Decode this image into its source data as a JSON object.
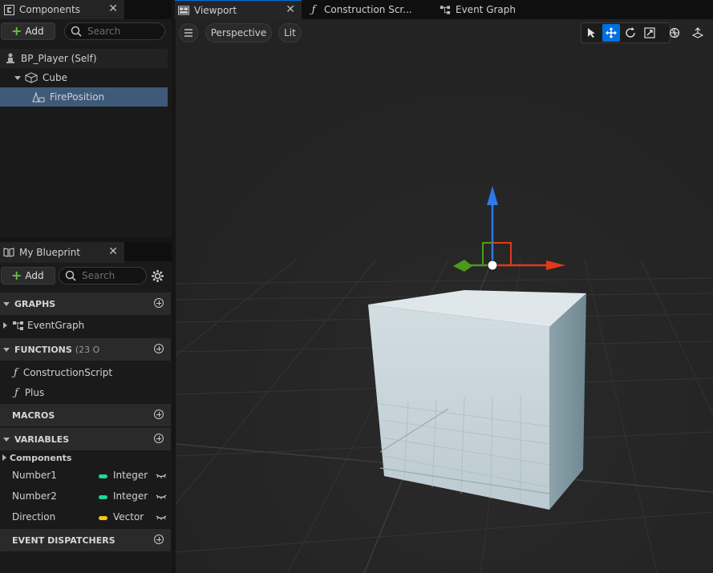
{
  "components_panel": {
    "tab_label": "Components",
    "add_label": "Add",
    "search_placeholder": "Search",
    "tree": [
      {
        "label": "BP_Player (Self)"
      },
      {
        "label": "Cube"
      },
      {
        "label": "FirePosition"
      }
    ]
  },
  "blueprint_panel": {
    "tab_label": "My Blueprint",
    "add_label": "Add",
    "search_placeholder": "Search",
    "sections": {
      "graphs": "GRAPHS",
      "functions": "FUNCTIONS",
      "functions_count": "(23 O",
      "macros": "MACROS",
      "variables": "VARIABLES",
      "event_dispatchers": "EVENT DISPATCHERS"
    },
    "graphs": [
      {
        "label": "EventGraph"
      }
    ],
    "functions": [
      {
        "label": "ConstructionScript"
      },
      {
        "label": "Plus"
      }
    ],
    "variable_category": "Components",
    "variables": [
      {
        "name": "Number1",
        "type": "Integer",
        "color": "#1fd4a0"
      },
      {
        "name": "Number2",
        "type": "Integer",
        "color": "#1fd4a0"
      },
      {
        "name": "Direction",
        "type": "Vector",
        "color": "#f5c518"
      }
    ]
  },
  "editor_tabs": [
    {
      "label": "Viewport"
    },
    {
      "label": "Construction Scr..."
    },
    {
      "label": "Event Graph"
    }
  ],
  "viewport": {
    "perspective_label": "Perspective",
    "lit_label": "Lit",
    "active_tool": "move"
  },
  "colors": {
    "accent": "#0070e0",
    "selection": "#3e5a78",
    "gizmo_x": "#e03a1a",
    "gizmo_y": "#4d9a1a",
    "gizmo_z": "#2f78e8"
  }
}
